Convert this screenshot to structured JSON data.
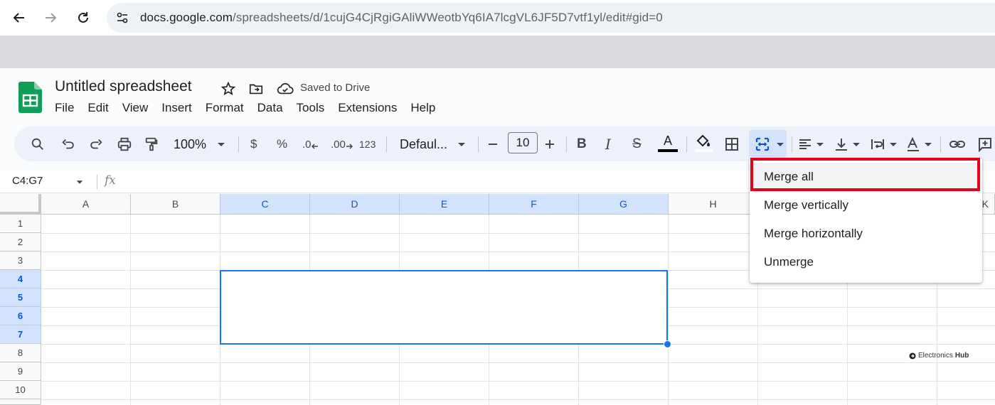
{
  "browser": {
    "url_host": "docs.google.com",
    "url_path": "/spreadsheets/d/1cujG4CjRgiGAliWWeotbYq6IA7lcgVL6JF5D7vtf1yl/edit#gid=0"
  },
  "doc": {
    "title": "Untitled spreadsheet",
    "saved_status": "Saved to Drive"
  },
  "menu": [
    "File",
    "Edit",
    "View",
    "Insert",
    "Format",
    "Data",
    "Tools",
    "Extensions",
    "Help"
  ],
  "toolbar": {
    "zoom": "100%",
    "currency": "$",
    "percent": "%",
    "dec_decrease": ".0",
    "dec_increase": ".00",
    "more_formats": "123",
    "font": "Defaul...",
    "font_size": "10",
    "bold": "B",
    "italic": "I",
    "strike": "S",
    "text_color": "A"
  },
  "formula_bar": {
    "name_box": "C4:G7",
    "fx": "fx"
  },
  "columns": [
    "A",
    "B",
    "C",
    "D",
    "E",
    "F",
    "G",
    "H",
    "K"
  ],
  "rows": [
    "1",
    "2",
    "3",
    "4",
    "5",
    "6",
    "7",
    "8",
    "9",
    "10"
  ],
  "selected_columns": [
    "C",
    "D",
    "E",
    "F",
    "G"
  ],
  "selected_rows": [
    "4",
    "5",
    "6",
    "7"
  ],
  "merge_menu": {
    "items": [
      "Merge all",
      "Merge vertically",
      "Merge horizontally",
      "Unmerge"
    ]
  },
  "watermark": {
    "brand": "Electronics",
    "brand_bold": "Hub"
  },
  "colors": {
    "accent": "#1a73e8",
    "highlight_box": "#e2001a",
    "sheets_green": "#0f9d58"
  }
}
